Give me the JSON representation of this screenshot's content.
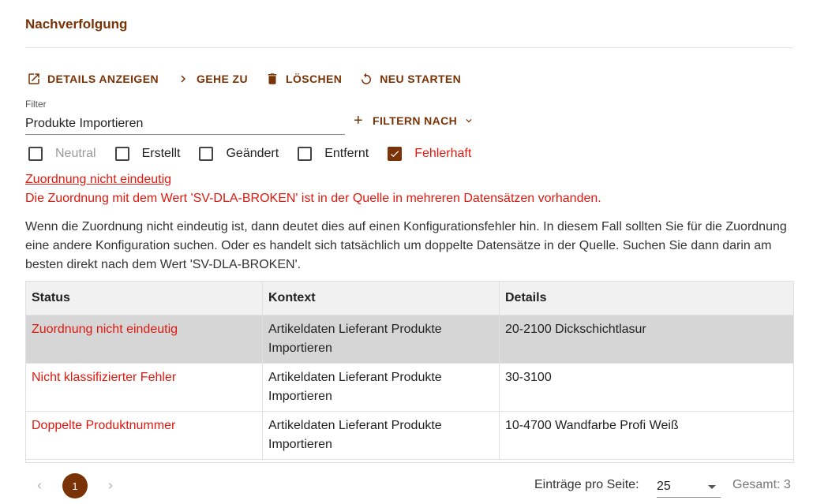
{
  "page": {
    "title": "Nachverfolgung"
  },
  "toolbar": {
    "details": {
      "label": "DETAILS ANZEIGEN",
      "icon": "open-in-new-icon"
    },
    "goto": {
      "label": "GEHE ZU",
      "icon": "chevron-right-icon"
    },
    "delete": {
      "label": "LÖSCHEN",
      "icon": "trash-icon"
    },
    "restart": {
      "label": "NEU STARTEN",
      "icon": "restart-icon"
    }
  },
  "filter": {
    "label": "Filter",
    "value": "Produkte Importieren",
    "filter_by_label": "FILTERN NACH"
  },
  "status_filters": [
    {
      "label": "Neutral",
      "checked": false
    },
    {
      "label": "Erstellt",
      "checked": false
    },
    {
      "label": "Geändert",
      "checked": false
    },
    {
      "label": "Entfernt",
      "checked": false
    },
    {
      "label": "Fehlerhaft",
      "checked": true
    }
  ],
  "error": {
    "title": "Zuordnung nicht eindeutig",
    "message": "Die Zuordnung mit dem Wert 'SV-DLA-BROKEN' ist in der Quelle in mehreren Datensätzen vorhanden.",
    "description": "Wenn die Zuordnung nicht eindeutig ist, dann deutet dies auf einen Konfigurationsfehler hin. In diesem Fall sollten Sie für die Zuordnung eine andere Konfiguration suchen. Oder es handelt sich tatsächlich um doppelte Datensätze in der Quelle. Suchen Sie dann darin am besten direkt nach dem Wert 'SV-DLA-BROKEN'."
  },
  "table": {
    "columns": [
      "Status",
      "Kontext",
      "Details"
    ],
    "rows": [
      {
        "status": "Zuordnung nicht eindeutig",
        "context": "Artikeldaten Lieferant Produkte Importieren",
        "details": "20-2100 Dickschichtlasur"
      },
      {
        "status": "Nicht klassifizierter Fehler",
        "context": "Artikeldaten Lieferant Produkte Importieren",
        "details": "30-3100"
      },
      {
        "status": "Doppelte Produktnummer",
        "context": "Artikeldaten Lieferant Produkte Importieren",
        "details": "10-4700 Wandfarbe Profi Weiß"
      }
    ]
  },
  "pagination": {
    "current_page": "1",
    "per_page_label": "Einträge pro Seite:",
    "per_page_value": "25",
    "total": "Gesamt: 3"
  },
  "colors": {
    "accent": "#7a3306",
    "error": "#e0190f",
    "selected_row": "#d6d6d6"
  }
}
